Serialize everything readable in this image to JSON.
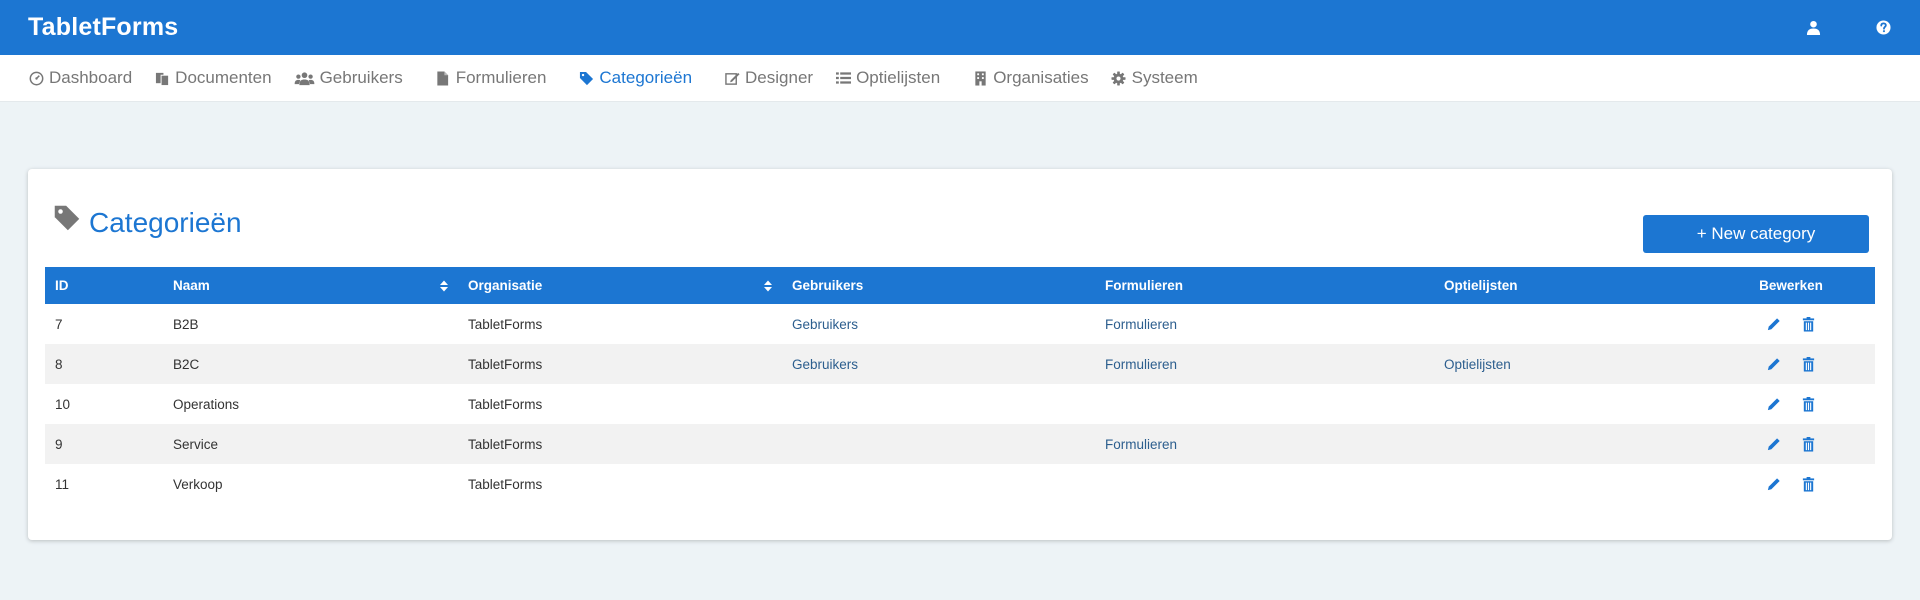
{
  "app": {
    "title": "TabletForms"
  },
  "header_icons": [
    "user-icon",
    "help-icon"
  ],
  "nav": [
    {
      "label": "Dashboard",
      "icon": "dashboard-icon",
      "active": false
    },
    {
      "label": "Documenten",
      "icon": "documents-icon",
      "active": false
    },
    {
      "label": "Gebruikers",
      "icon": "users-icon",
      "active": false
    },
    {
      "label": "Formulieren",
      "icon": "file-icon",
      "active": false
    },
    {
      "label": "Categorieën",
      "icon": "tag-icon",
      "active": true
    },
    {
      "label": "Designer",
      "icon": "edit-icon",
      "active": false
    },
    {
      "label": "Optielijsten",
      "icon": "list-icon",
      "active": false
    },
    {
      "label": "Organisaties",
      "icon": "building-icon",
      "active": false
    },
    {
      "label": "Systeem",
      "icon": "gear-icon",
      "active": false
    }
  ],
  "page": {
    "title": "Categorieën",
    "new_button": "+ New category"
  },
  "table": {
    "columns": {
      "id": "ID",
      "naam": "Naam",
      "organisatie": "Organisatie",
      "gebruikers": "Gebruikers",
      "formulieren": "Formulieren",
      "optielijsten": "Optielijsten",
      "bewerken": "Bewerken"
    },
    "rows": [
      {
        "id": "7",
        "naam": "B2B",
        "organisatie": "TabletForms",
        "gebruikers": "Gebruikers",
        "formulieren": "Formulieren",
        "optielijsten": ""
      },
      {
        "id": "8",
        "naam": "B2C",
        "organisatie": "TabletForms",
        "gebruikers": "Gebruikers",
        "formulieren": "Formulieren",
        "optielijsten": "Optielijsten"
      },
      {
        "id": "10",
        "naam": "Operations",
        "organisatie": "TabletForms",
        "gebruikers": "",
        "formulieren": "",
        "optielijsten": ""
      },
      {
        "id": "9",
        "naam": "Service",
        "organisatie": "TabletForms",
        "gebruikers": "",
        "formulieren": "Formulieren",
        "optielijsten": ""
      },
      {
        "id": "11",
        "naam": "Verkoop",
        "organisatie": "TabletForms",
        "gebruikers": "",
        "formulieren": "",
        "optielijsten": ""
      }
    ]
  },
  "colors": {
    "primary": "#1c76d2",
    "link": "#2c5e8e",
    "background": "#edf3f6"
  }
}
